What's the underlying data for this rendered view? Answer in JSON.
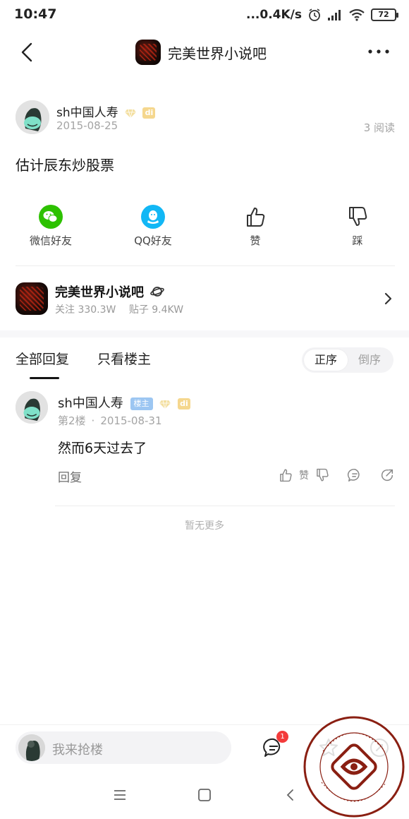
{
  "status_bar": {
    "time": "10:47",
    "net_speed": "...0.4K/s",
    "battery": "72"
  },
  "header": {
    "forum_title": "完美世界小说吧"
  },
  "post": {
    "author": "sh中国人寿",
    "level_badge": "di",
    "date": "2015-08-25",
    "read_count": "3 阅读",
    "title": "估计辰东炒股票"
  },
  "share_actions": [
    {
      "label": "微信好友",
      "icon": "wechat-icon"
    },
    {
      "label": "QQ好友",
      "icon": "qq-icon"
    },
    {
      "label": "赞",
      "icon": "thumbs-up-icon"
    },
    {
      "label": "踩",
      "icon": "thumbs-down-icon"
    }
  ],
  "forum_card": {
    "name": "完美世界小说吧",
    "followers": "关注 330.3W",
    "posts": "贴子 9.4KW"
  },
  "tabs": {
    "all": "全部回复",
    "owner_only": "只看楼主",
    "sort_asc": "正序",
    "sort_desc": "倒序"
  },
  "reply": {
    "author": "sh中国人寿",
    "owner_badge": "楼主",
    "level_badge": "di",
    "floor": "第2楼",
    "separator": "·",
    "date": "2015-08-31",
    "content": "然而6天过去了",
    "reply_label": "回复",
    "like_label": "赞"
  },
  "no_more": "暂无更多",
  "bottom_bar": {
    "input_placeholder": "我来抢楼",
    "comment_badge": "1"
  },
  "colors": {
    "wechat_green": "#2dc100",
    "qq_blue": "#12b7f5",
    "badge_red": "#f33b3b",
    "owner_badge_blue": "#9cc6f2",
    "level_badge_gold": "#f5d78e"
  }
}
